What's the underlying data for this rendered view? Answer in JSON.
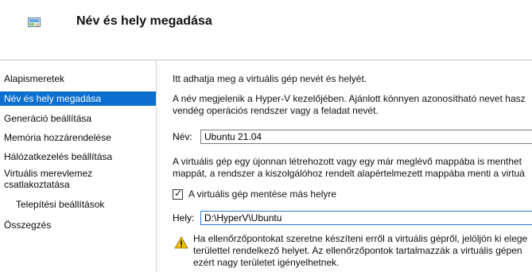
{
  "header": {
    "title": "Név és hely megadása",
    "icon": "wizard-icon"
  },
  "sidebar": {
    "items": [
      {
        "label": "Alapismeretek",
        "selected": false
      },
      {
        "label": "Név és hely megadása",
        "selected": true
      },
      {
        "label": "Generáció beállítása",
        "selected": false
      },
      {
        "label": "Memória hozzárendelése",
        "selected": false
      },
      {
        "label": "Hálózatkezelés beállítása",
        "selected": false
      },
      {
        "label": "Virtuális merevlemez csatlakoztatása",
        "selected": false
      },
      {
        "label": "Telepítési beállítások",
        "selected": false
      },
      {
        "label": "Összegzés",
        "selected": false
      }
    ]
  },
  "main": {
    "intro": "Itt adhatja meg a virtuális gép nevét és helyét.",
    "desc_line1": "A név megjelenik a Hyper-V kezelőjében. Ajánlott könnyen azonosítható nevet hasz",
    "desc_line2": "vendég operációs rendszer vagy a feladat nevét.",
    "name_label": "Név:",
    "name_value": "Ubuntu 21.04",
    "store_line1": "A virtuális gép egy újonnan létrehozott vagy egy már meglévő mappába is menthet",
    "store_line2": "mappát, a rendszer a kiszolgálóhoz rendelt alapértelmezett mappába menti a virtuá",
    "checkbox_label": "A virtuális gép mentése más helyre",
    "checkbox_checked": true,
    "location_label": "Hely:",
    "location_value": "D:\\HyperV\\Ubuntu",
    "warn_line1": "Ha ellenőrzőpontokat szeretne készíteni erről a virtuális gépről, jelöljön ki elege",
    "warn_line2": "területtel rendelkező helyet. Az ellenőrzőpontok tartalmazzák a virtuális gépen",
    "warn_line3": "ezért nagy területet igényelhetnek.",
    "warn_icon": "warning-icon"
  },
  "colors": {
    "selection": "#0b6fd0",
    "focus_border": "#2a7ad8",
    "warning": "#f2c200"
  }
}
